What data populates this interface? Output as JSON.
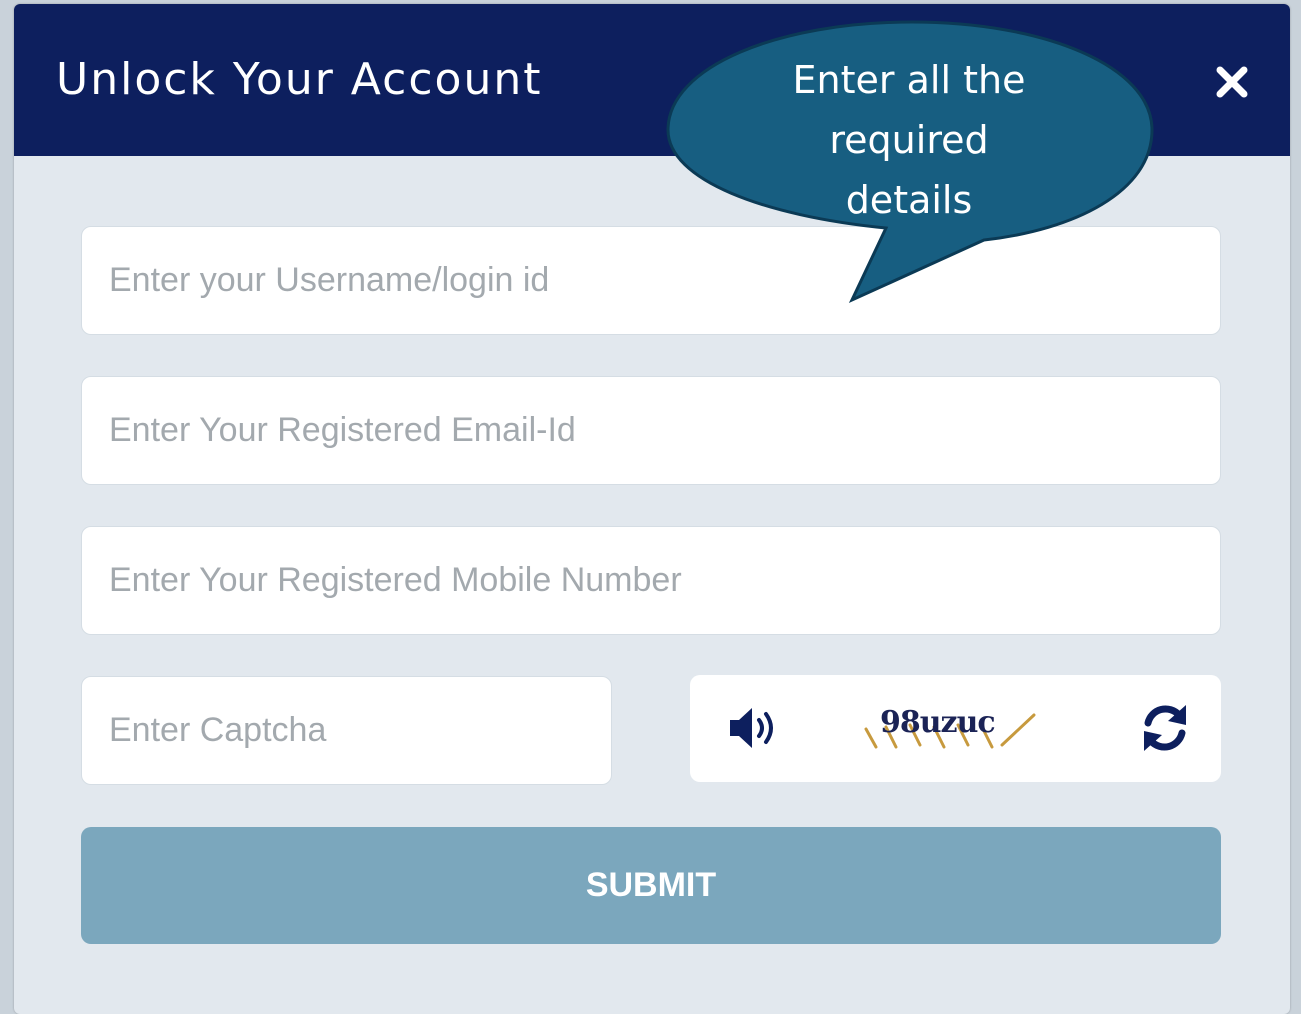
{
  "modal": {
    "title": "Unlock Your Account",
    "close_icon": "close-icon"
  },
  "form": {
    "username_placeholder": "Enter your Username/login id",
    "email_placeholder": "Enter Your Registered Email-Id",
    "mobile_placeholder": "Enter Your Registered Mobile Number",
    "captcha_placeholder": "Enter Captcha",
    "captcha_code": "98uzuc",
    "audio_icon": "speaker-icon",
    "refresh_icon": "refresh-icon",
    "submit_label": "SUBMIT"
  },
  "callout": {
    "line1": "Enter all the",
    "line2": "required",
    "line3": "details"
  },
  "colors": {
    "header_bg": "#0d1f5e",
    "modal_bg": "#e2e8ee",
    "submit_bg": "#7ba7bd",
    "callout_fill": "#175e81"
  }
}
